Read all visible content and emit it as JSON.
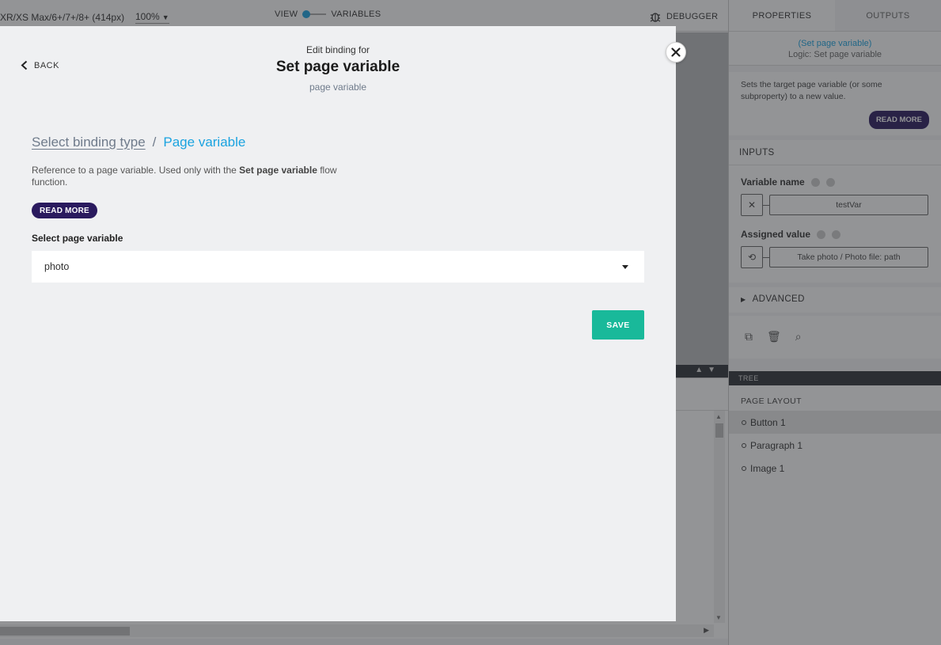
{
  "app": {
    "device_label": "XR/XS Max/6+/7+/8+ (414px)",
    "zoom": "100%",
    "view_label": "VIEW",
    "variables_label": "VARIABLES",
    "debugger_label": "DEBUGGER"
  },
  "right_panel": {
    "tabs": [
      "PROPERTIES",
      "OUTPUTS"
    ],
    "header_link": "(Set page variable)",
    "header_sub": "Logic: Set page variable",
    "description": "Sets the target page variable (or some subproperty) to a new value.",
    "read_more": "READ MORE",
    "inputs_title": "INPUTS",
    "variable_name_label": "Variable name",
    "variable_name_value": "testVar",
    "assigned_value_label": "Assigned value",
    "assigned_value_value": "Take photo / Photo file: path",
    "advanced_label": "ADVANCED",
    "tree_label": "TREE",
    "tree_title": "PAGE LAYOUT",
    "tree_nodes": [
      "Button 1",
      "Paragraph 1",
      "Image 1"
    ]
  },
  "modal": {
    "back_label": "BACK",
    "kicker": "Edit binding for",
    "title": "Set page variable",
    "subtitle": "page variable",
    "breadcrumb_link": "Select binding type",
    "breadcrumb_sep": "/",
    "breadcrumb_current": "Page variable",
    "desc_pre": "Reference to a page variable. Used only with the ",
    "desc_bold": "Set page variable",
    "desc_post": " flow function.",
    "read_more": "READ MORE",
    "select_label": "Select page variable",
    "select_value": "photo",
    "save_label": "SAVE"
  },
  "colors": {
    "accent_blue": "#1aa3e0",
    "save_green": "#19b99a",
    "read_more_purple": "#2a1a5e"
  }
}
